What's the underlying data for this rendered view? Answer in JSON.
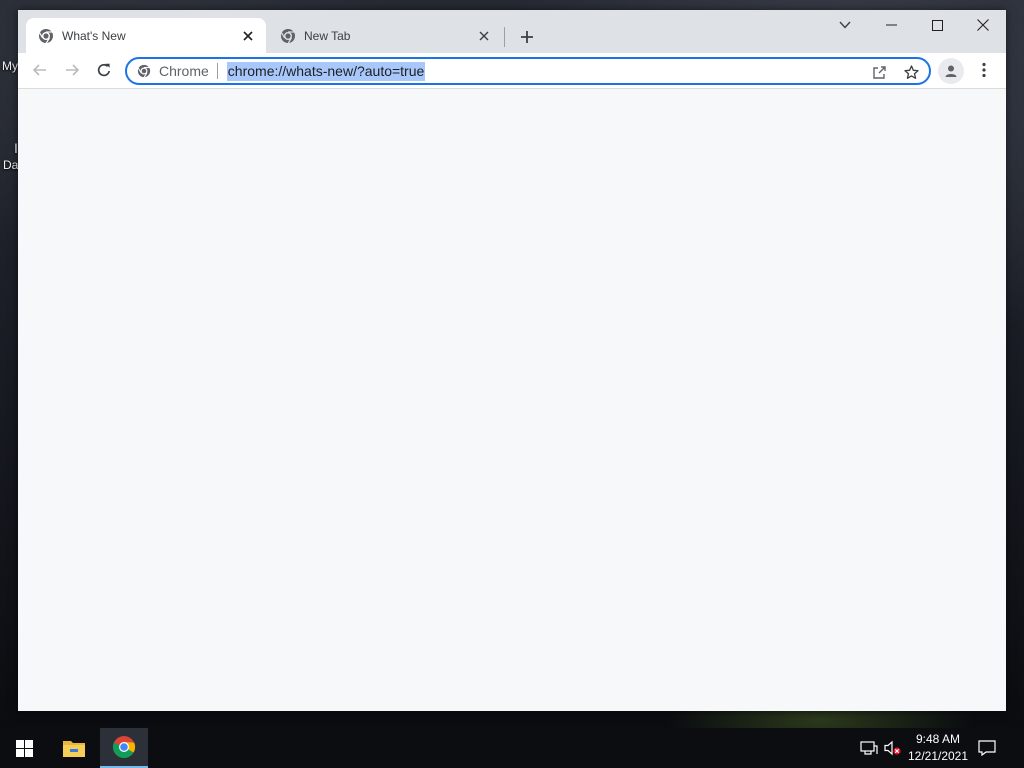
{
  "desktop": {
    "labels": [
      "My",
      "I",
      "Da"
    ]
  },
  "browser": {
    "tabs": [
      {
        "title": "What's New",
        "active": true,
        "icon": "chrome-icon"
      },
      {
        "title": "New Tab",
        "active": false,
        "icon": "chrome-icon"
      }
    ],
    "omnibox": {
      "chip_label": "Chrome",
      "url": "chrome://whats-new/?auto=true",
      "url_selected": true
    },
    "accent_color": "#1a73e8",
    "selection_color": "#a8c7fa",
    "page_background": "#f7f8fa"
  },
  "taskbar": {
    "pinned": [
      "windows-start-icon",
      "file-explorer-icon",
      "chrome-icon"
    ],
    "clock": {
      "time": "9:48 AM",
      "date": "12/21/2021"
    },
    "tray": [
      "network-icon",
      "volume-muted-icon",
      "notifications-icon"
    ]
  }
}
